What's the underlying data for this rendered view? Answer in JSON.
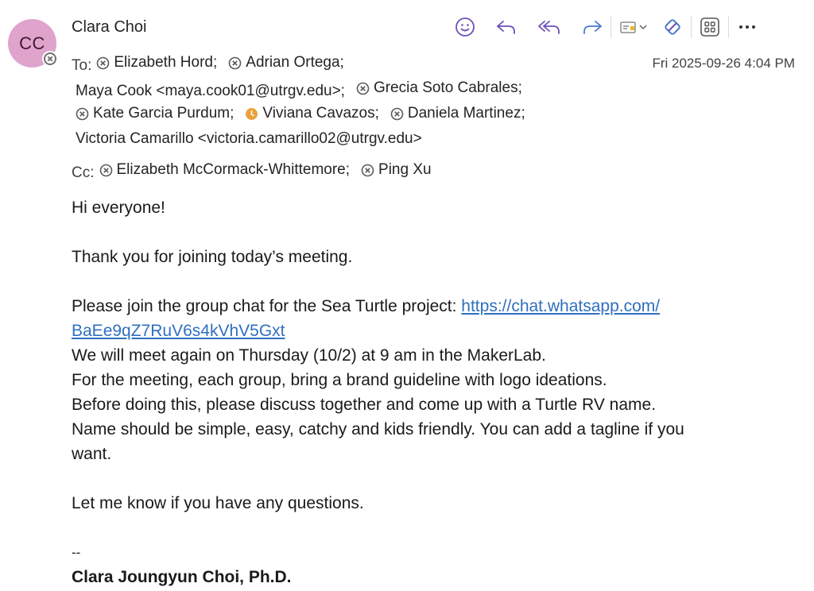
{
  "sender": {
    "initials": "CC",
    "name": "Clara Choi"
  },
  "date": "Fri 2025-09-26 4:04 PM",
  "to_label": "To:",
  "cc_label": "Cc:",
  "to_line1": [
    {
      "name": "Elizabeth Hord;",
      "icon": "x"
    },
    {
      "name": "Adrian Ortega;",
      "icon": "x"
    }
  ],
  "to_line2": [
    {
      "name": "Maya Cook <maya.cook01@utrgv.edu>;",
      "icon": ""
    },
    {
      "name": "Grecia Soto Cabrales;",
      "icon": "x"
    }
  ],
  "to_line3": [
    {
      "name": "Kate Garcia Purdum;",
      "icon": "x"
    },
    {
      "name": "Viviana Cavazos;",
      "icon": "clock"
    },
    {
      "name": "Daniela Martinez;",
      "icon": "x"
    }
  ],
  "to_line4": [
    {
      "name": "Victoria Camarillo <victoria.camarillo02@utrgv.edu>",
      "icon": ""
    }
  ],
  "cc": [
    {
      "name": "Elizabeth McCormack-Whittemore;",
      "icon": "x"
    },
    {
      "name": "Ping Xu",
      "icon": "x"
    }
  ],
  "body": {
    "greeting": "Hi everyone!",
    "thanks": "Thank you for joining today’s meeting.",
    "join_text": "Please join the group chat for the Sea Turtle project: ",
    "link_part1": "https://chat.whatsapp.com/",
    "link_part2": "BaEe9qZ7RuV6s4kVhV5Gxt",
    "meet": "We will meet again on Thursday (10/2) at 9 am in the MakerLab.",
    "bring": "For the meeting, each group, bring a brand guideline with logo ideations.",
    "before": "Before doing this, please discuss together and come up with a Turtle RV name.",
    "name_line1": "Name should be simple, easy, catchy and kids friendly. You can add a tagline if you",
    "name_line2": "want.",
    "questions": "Let me know if you have any questions.",
    "sig_dash": "--",
    "sig_name": "Clara Joungyun Choi, Ph.D."
  },
  "colors": {
    "avatar": "#dfa3cc",
    "accent": "#6c4fb8",
    "link": "#2f6fbf",
    "away": "#e8a33d"
  }
}
